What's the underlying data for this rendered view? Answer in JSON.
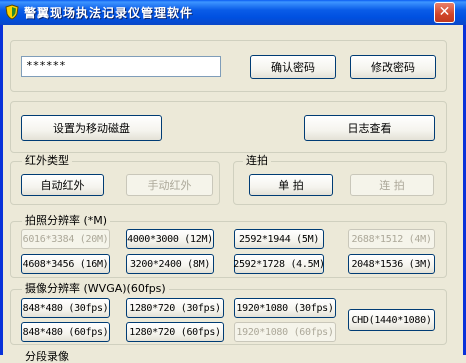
{
  "window": {
    "title": "警翼现场执法记录仪管理软件",
    "close_glyph": "✕"
  },
  "password": {
    "value": "******"
  },
  "top_buttons": {
    "confirm": "确认密码",
    "change": "修改密码",
    "mobile_disk": "设置为移动磁盘",
    "log_view": "日志查看"
  },
  "infrared": {
    "label": "红外类型",
    "auto": "自动红外",
    "manual": "手动红外"
  },
  "burst": {
    "label": "连拍",
    "single": "单 拍",
    "continuous": "连 拍"
  },
  "photo_res": {
    "label": "拍照分辨率 (*M)",
    "items": [
      "6016*3384 (20M)",
      "4000*3000 (12M)",
      "2592*1944 (5M)",
      "2688*1512 (4M)",
      "4608*3456 (16M)",
      "3200*2400 (8M)",
      "2592*1728 (4.5M)",
      "2048*1536 (3M)"
    ]
  },
  "video_res": {
    "label": "摄像分辨率 (WVGA)(60fps)",
    "items": [
      "848*480 (30fps)",
      "1280*720 (30fps)",
      "1920*1080 (30fps)",
      "848*480 (60fps)",
      "1280*720 (60fps)",
      "1920*1080 (60fps)",
      "CHD(1440*1080)"
    ]
  },
  "segment": {
    "label": "分段录像"
  }
}
